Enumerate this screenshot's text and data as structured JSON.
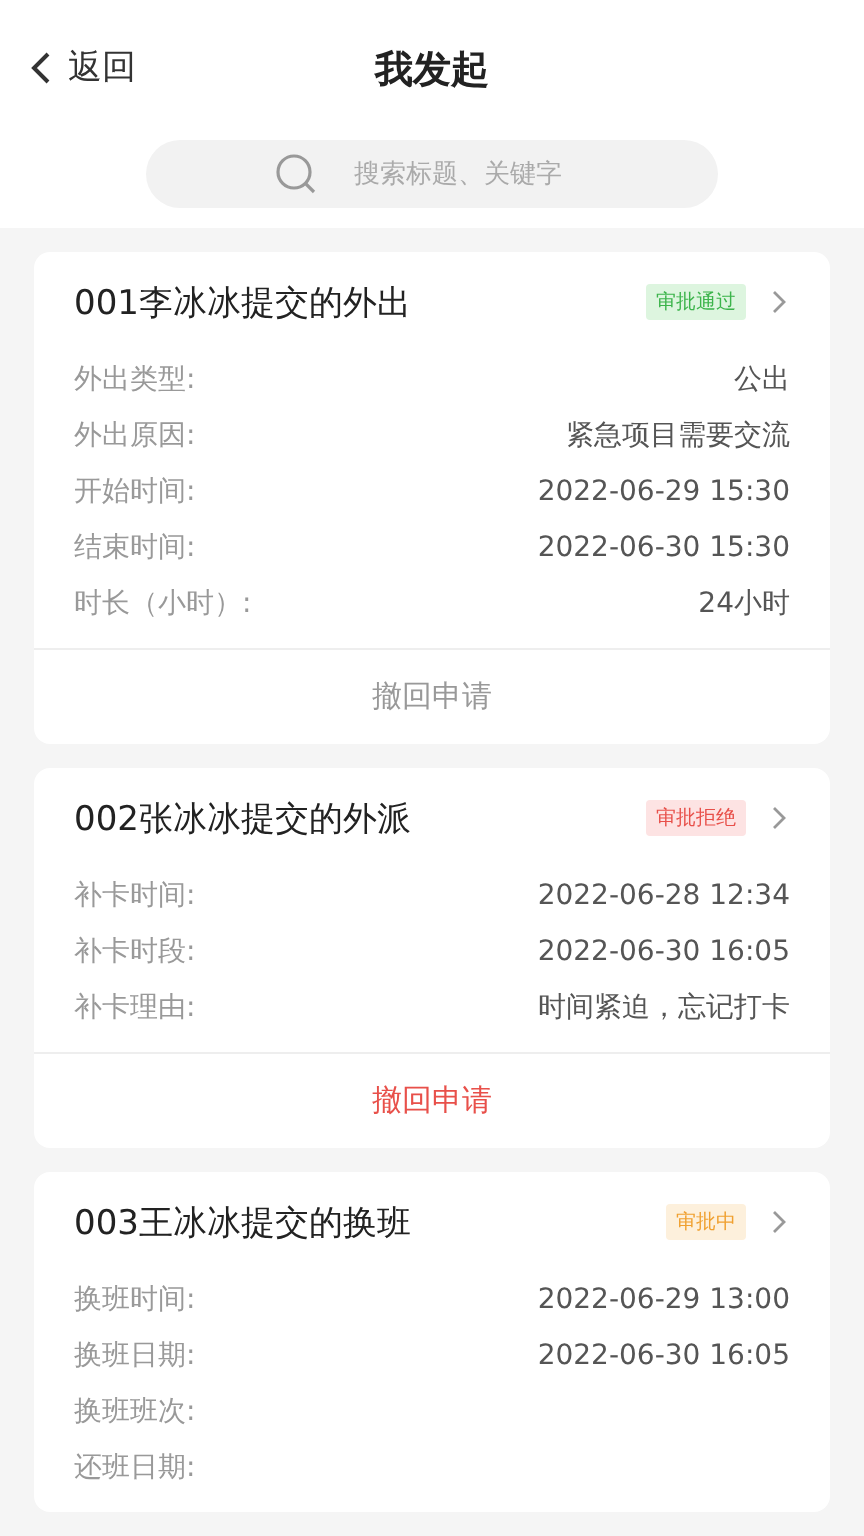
{
  "header": {
    "back": "返回",
    "title": "我发起"
  },
  "search": {
    "placeholder": "搜索标题、关键字"
  },
  "cards": [
    {
      "title": "001李冰冰提交的外出",
      "status": {
        "kind": "approved",
        "label": "审批通过"
      },
      "fields": [
        {
          "label": "外出类型:",
          "value": "公出"
        },
        {
          "label": "外出原因:",
          "value": "紧急项目需要交流"
        },
        {
          "label": "开始时间:",
          "value": "2022-06-29 15:30"
        },
        {
          "label": "结束时间:",
          "value": "2022-06-30 15:30"
        },
        {
          "label": "时长（小时）:",
          "value": "24小时"
        }
      ],
      "action": {
        "label": "撤回申请",
        "disabled": true
      }
    },
    {
      "title": "002张冰冰提交的外派",
      "status": {
        "kind": "rejected",
        "label": "审批拒绝"
      },
      "fields": [
        {
          "label": "补卡时间:",
          "value": "2022-06-28 12:34"
        },
        {
          "label": "补卡时段:",
          "value": "2022-06-30 16:05"
        },
        {
          "label": "补卡理由:",
          "value": "时间紧迫，忘记打卡"
        }
      ],
      "action": {
        "label": "撤回申请",
        "disabled": false
      }
    },
    {
      "title": "003王冰冰提交的换班",
      "status": {
        "kind": "pending",
        "label": "审批中"
      },
      "fields": [
        {
          "label": "换班时间:",
          "value": "2022-06-29 13:00"
        },
        {
          "label": "换班日期:",
          "value": "2022-06-30 16:05"
        },
        {
          "label": "换班班次:"
        },
        {
          "label": "还班日期:"
        }
      ]
    }
  ]
}
